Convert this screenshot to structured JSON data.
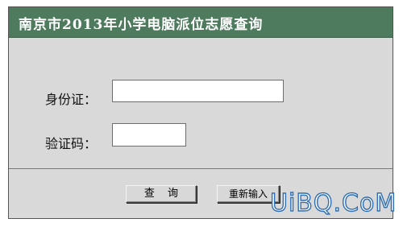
{
  "header": {
    "title": "南京市2013年小学电脑派位志愿查询"
  },
  "form": {
    "id_label": "身份证：",
    "id_value": "",
    "code_label": "验证码：",
    "code_value": ""
  },
  "buttons": {
    "submit_label": "查 询",
    "reset_label": "重新输入"
  },
  "watermark": {
    "text": "UiBQ.CoM"
  },
  "colors": {
    "header_bg": "#4e7a5d",
    "panel_bg": "#d9d9d9",
    "watermark_stroke": "#2f6fb5"
  }
}
